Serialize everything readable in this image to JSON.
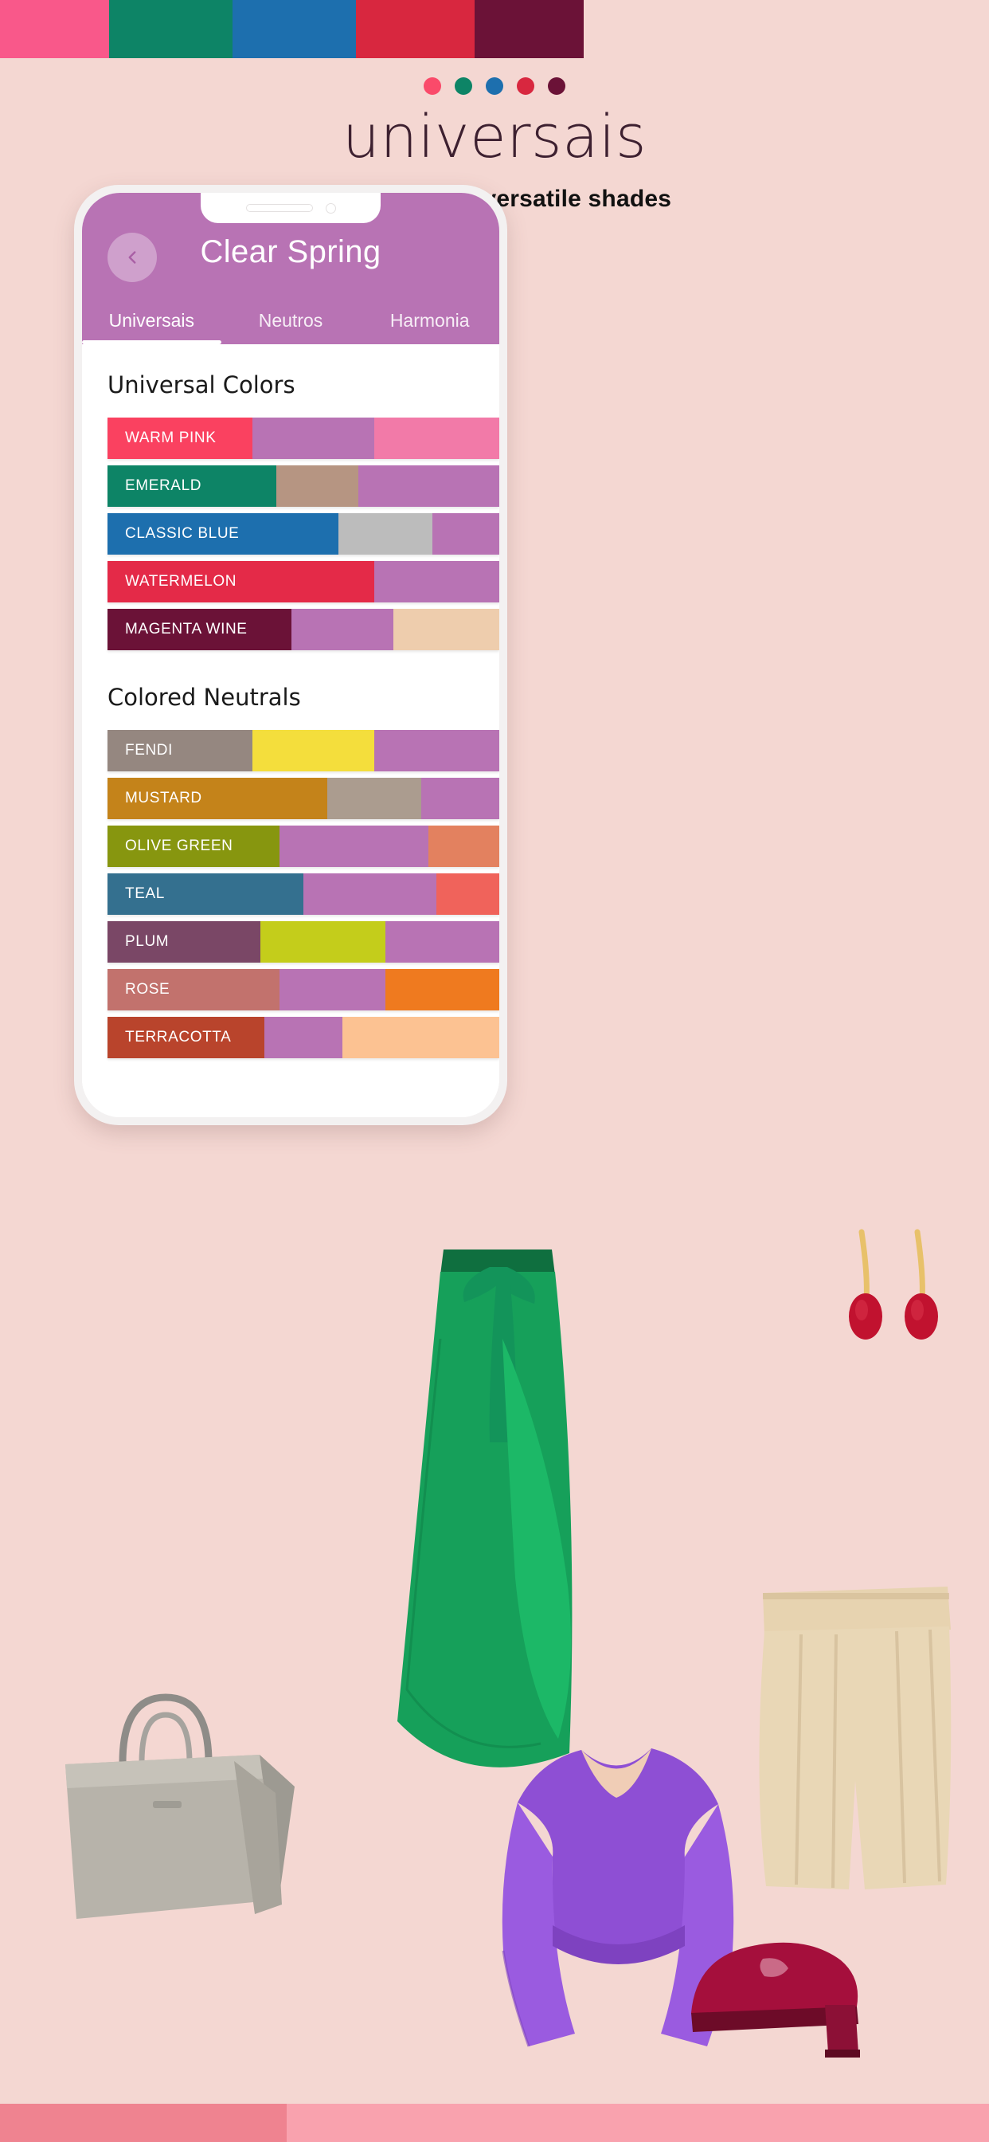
{
  "top_strip": [
    {
      "name": "warm-pink",
      "color": "#f9588a",
      "width": "11%"
    },
    {
      "name": "emerald",
      "color": "#0d8466",
      "width": "12.5%"
    },
    {
      "name": "classic-blue",
      "color": "#1d6fae",
      "width": "12.5%"
    },
    {
      "name": "watermelon",
      "color": "#d8273f",
      "width": "12%"
    },
    {
      "name": "magenta-wine",
      "color": "#6b1237",
      "width": "11%"
    },
    {
      "name": "background",
      "color": "#f4d7d2",
      "width": "41%"
    }
  ],
  "brand": {
    "dots": [
      "#fa4a6a",
      "#0d8466",
      "#1d6fae",
      "#d8273f",
      "#6b1237"
    ],
    "wordmark": "universais",
    "tagline": "Combine with versatile shades"
  },
  "app": {
    "screen_title": "Clear Spring",
    "back_icon": "chevron-left-icon",
    "header_color": "#b873b4",
    "tabs": [
      {
        "label": "Universais",
        "active": true
      },
      {
        "label": "Neutros",
        "active": false
      },
      {
        "label": "Harmonia",
        "active": false
      }
    ],
    "sections": [
      {
        "id": "universal-colors",
        "title": "Universal Colors",
        "rows": [
          {
            "label": "WARM PINK",
            "segments": [
              {
                "color": "#fa4160",
                "width": "37%"
              },
              {
                "color": "#b873b4",
                "width": "31%"
              },
              {
                "color": "#f27aa8",
                "width": "32%"
              }
            ]
          },
          {
            "label": "EMERALD",
            "segments": [
              {
                "color": "#0d8466",
                "width": "43%"
              },
              {
                "color": "#b69582",
                "width": "21%"
              },
              {
                "color": "#b873b4",
                "width": "36%"
              }
            ]
          },
          {
            "label": "CLASSIC BLUE",
            "segments": [
              {
                "color": "#1d6fae",
                "width": "59%"
              },
              {
                "color": "#bcbcbc",
                "width": "24%"
              },
              {
                "color": "#b873b4",
                "width": "17%"
              }
            ]
          },
          {
            "label": "WATERMELON",
            "segments": [
              {
                "color": "#e42a48",
                "width": "68%"
              },
              {
                "color": "#b873b4",
                "width": "32%"
              }
            ]
          },
          {
            "label": "MAGENTA WINE",
            "segments": [
              {
                "color": "#6b1237",
                "width": "47%"
              },
              {
                "color": "#b873b4",
                "width": "26%"
              },
              {
                "color": "#eecdad",
                "width": "27%"
              }
            ]
          }
        ]
      },
      {
        "id": "colored-neutrals",
        "title": "Colored Neutrals",
        "rows": [
          {
            "label": "FENDI",
            "segments": [
              {
                "color": "#958780",
                "width": "37%"
              },
              {
                "color": "#f4de3c",
                "width": "31%"
              },
              {
                "color": "#b873b4",
                "width": "32%"
              }
            ]
          },
          {
            "label": "MUSTARD",
            "segments": [
              {
                "color": "#c4831a",
                "width": "56%"
              },
              {
                "color": "#ab9c8f",
                "width": "24%"
              },
              {
                "color": "#b873b4",
                "width": "20%"
              }
            ]
          },
          {
            "label": "OLIVE GREEN",
            "segments": [
              {
                "color": "#87960f",
                "width": "44%"
              },
              {
                "color": "#b873b4",
                "width": "38%"
              },
              {
                "color": "#e3815f",
                "width": "18%"
              }
            ]
          },
          {
            "label": "TEAL",
            "segments": [
              {
                "color": "#34708f",
                "width": "50%"
              },
              {
                "color": "#b873b4",
                "width": "34%"
              },
              {
                "color": "#f0635b",
                "width": "16%"
              }
            ]
          },
          {
            "label": "PLUM",
            "segments": [
              {
                "color": "#7a4766",
                "width": "39%"
              },
              {
                "color": "#c4cd1b",
                "width": "32%"
              },
              {
                "color": "#b873b4",
                "width": "29%"
              }
            ]
          },
          {
            "label": "ROSE",
            "segments": [
              {
                "color": "#c2726d",
                "width": "44%"
              },
              {
                "color": "#b873b4",
                "width": "27%"
              },
              {
                "color": "#ef7a1f",
                "width": "29%"
              }
            ]
          },
          {
            "label": "TERRACOTTA",
            "segments": [
              {
                "color": "#b9442c",
                "width": "40%"
              },
              {
                "color": "#b873b4",
                "width": "20%"
              },
              {
                "color": "#fcc292",
                "width": "40%"
              }
            ]
          }
        ]
      }
    ]
  },
  "collage": {
    "items": [
      {
        "name": "earrings",
        "label": "ruby-teardrop-earrings"
      },
      {
        "name": "green-skirt",
        "label": "emerald-ruffle-wrap-skirt"
      },
      {
        "name": "beige-shorts",
        "label": "beige-pleated-shorts"
      },
      {
        "name": "purple-blouse",
        "label": "purple-crop-blouse"
      },
      {
        "name": "handbag",
        "label": "grey-leather-handbag"
      },
      {
        "name": "flat-shoe",
        "label": "burgundy-flat-shoe"
      }
    ]
  },
  "bottom_strip": [
    {
      "name": "rose",
      "color": "#ef8390",
      "width": "29%"
    },
    {
      "name": "pink",
      "color": "#f9a2ae",
      "width": "71%"
    }
  ]
}
